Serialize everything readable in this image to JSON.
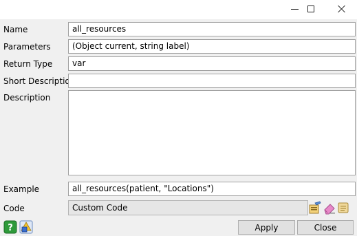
{
  "window": {
    "controls": {
      "minimize_icon": "minimize-icon",
      "maximize_icon": "maximize-icon",
      "close_icon": "close-icon"
    }
  },
  "form": {
    "name": {
      "label": "Name",
      "value": "all_resources"
    },
    "parameters": {
      "label": "Parameters",
      "value": "(Object current, string label)"
    },
    "return_type": {
      "label": "Return Type",
      "value": "var"
    },
    "short_description": {
      "label": "Short Description",
      "value": ""
    },
    "description": {
      "label": "Description",
      "value": ""
    },
    "example": {
      "label": "Example",
      "value": "all_resources(patient, \"Locations\")"
    },
    "code": {
      "label": "Code",
      "value": "Custom Code"
    }
  },
  "code_tools": [
    "edit-code-icon",
    "eraser-icon",
    "scroll-icon"
  ],
  "footer": {
    "help_icon": "help-icon",
    "shapes_icon": "shapes-icon",
    "apply_label": "Apply",
    "close_label": "Close"
  }
}
